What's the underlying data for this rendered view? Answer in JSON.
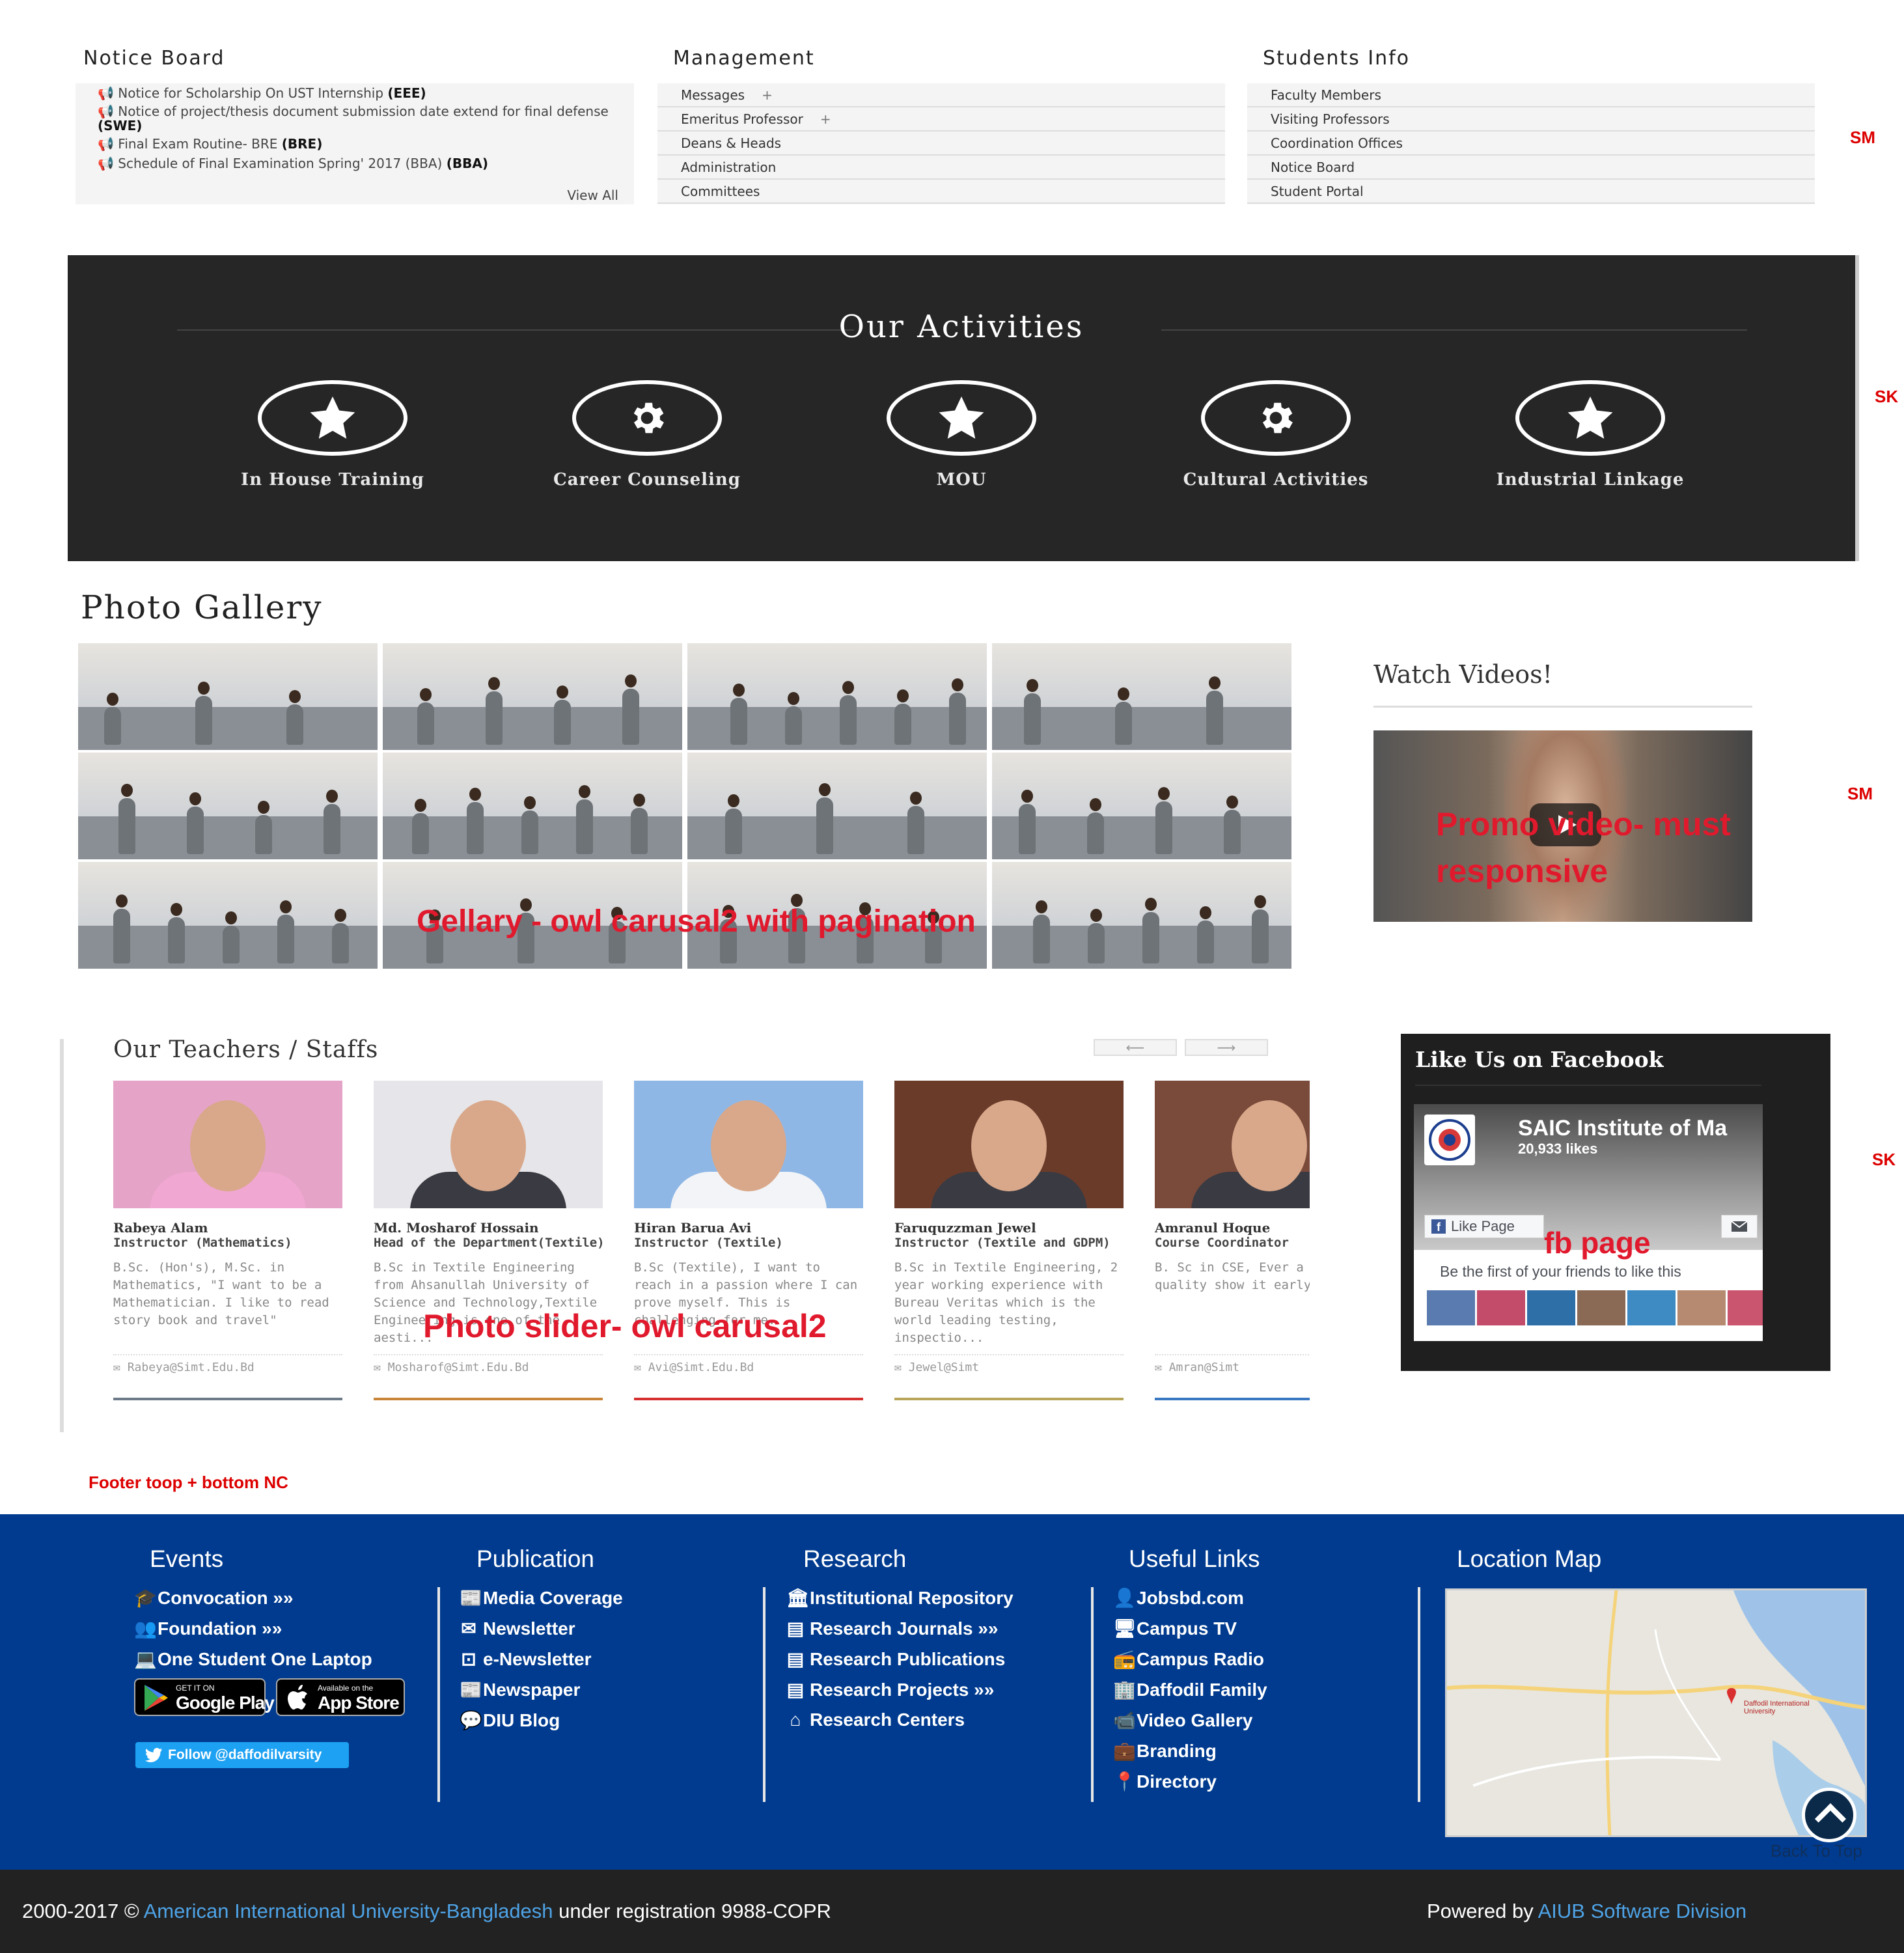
{
  "notice_board": {
    "title": "Notice Board",
    "items": [
      {
        "text": "Notice for Scholarship On UST Internship",
        "tag": "(EEE)"
      },
      {
        "text": "Notice of project/thesis document submission date extend for final defense",
        "tag": "(SWE)"
      },
      {
        "text": "Final Exam Routine- BRE",
        "tag": "(BRE)"
      },
      {
        "text": "Schedule of Final Examination Spring' 2017 (BBA)",
        "tag": "(BBA)"
      }
    ],
    "view_all": "View All"
  },
  "management": {
    "title": "Management",
    "items": [
      {
        "label": "Messages",
        "expand": "+"
      },
      {
        "label": "Emeritus Professor",
        "expand": "+"
      },
      {
        "label": "Deans & Heads",
        "expand": ""
      },
      {
        "label": "Administration",
        "expand": ""
      },
      {
        "label": "Committees",
        "expand": ""
      }
    ]
  },
  "students_info": {
    "title": "Students Info",
    "items": [
      "Faculty Members",
      "Visiting Professors",
      "Coordination Offices",
      "Notice Board",
      "Student Portal"
    ]
  },
  "side_tags": {
    "top": "SM",
    "activities": "SK",
    "video": "SM",
    "facebook": "SK"
  },
  "activities": {
    "title": "Our Activities",
    "items": [
      {
        "label": "In House Training",
        "icon": "star-icon"
      },
      {
        "label": "Career Counseling",
        "icon": "gear-icon"
      },
      {
        "label": "MOU",
        "icon": "star-icon"
      },
      {
        "label": "Cultural Activities",
        "icon": "gear-icon"
      },
      {
        "label": "Industrial Linkage",
        "icon": "star-icon"
      }
    ]
  },
  "gallery": {
    "title": "Photo Gallery",
    "annotation": "Gellary - owl carusal2 with pagination",
    "photo_count": 12
  },
  "video": {
    "title": "Watch Videos!",
    "annotation": "Promo video- must responsive"
  },
  "teachers": {
    "title": "Our Teachers / Staffs",
    "prev": "⟵",
    "next": "⟶",
    "annotation": "Photo slider- owl carusal2",
    "items": [
      {
        "name": "Rabeya Alam",
        "role": "Instructor (Mathematics)",
        "desc": "B.Sc. (Hon's), M.Sc. in Mathematics, \"I want to be a Mathematician. I like to read story book and travel\"",
        "email": "Rabeya@Simt.Edu.Bd",
        "color": "#e5a3c8",
        "bar": "#6c7a89"
      },
      {
        "name": "Md. Mosharof Hossain",
        "role": "Head of the Department(Textile)",
        "desc": "B.Sc in Textile Engineering from Ahsanullah University of Science and Technology,Textile Engineering is one of the aesti...",
        "email": "Mosharof@Simt.Edu.Bd",
        "color": "#e6e6ea",
        "bar": "#c9863a"
      },
      {
        "name": "Hiran Barua Avi",
        "role": "Instructor (Textile)",
        "desc": "B.Sc (Textile), I want to reach in a passion where I can prove myself. This is challenging for me.",
        "email": "Avi@Simt.Edu.Bd",
        "color": "#8fb7e6",
        "bar": "#d62f2f"
      },
      {
        "name": "Faruquzzman Jewel",
        "role": "Instructor (Textile and GDPM)",
        "desc": "B.Sc in Textile Engineering, 2 year working experience with Bureau Veritas which is the world leading testing, inspectio...",
        "email": "Jewel@Simt",
        "color": "#6b3b2a",
        "bar": "#b8a55a"
      },
      {
        "name": "Amranul Hoque",
        "role": "Course Coordinator",
        "desc": "B. Sc in CSE, Ever a different quality show it early",
        "email": "Amran@Simt",
        "color": "#7a4a3a",
        "bar": "#3a78c2"
      }
    ]
  },
  "facebook": {
    "title": "Like Us on Facebook",
    "page_name": "SAIC Institute of Ma",
    "likes": "20,933 likes",
    "like_button": "Like Page",
    "friends_text": "Be the first of your friends to like this",
    "annotation": "fb page"
  },
  "footer_note": "Footer toop + bottom NC",
  "footer": {
    "events": {
      "title": "Events",
      "links": [
        {
          "label": "Convocation »»",
          "icon": "graduation-cap-icon"
        },
        {
          "label": "Foundation »»",
          "icon": "users-icon"
        },
        {
          "label": "One Student One Laptop",
          "icon": "laptop-icon"
        }
      ],
      "google_play_small": "GET IT ON",
      "google_play": "Google Play",
      "app_store_small": "Available on the",
      "app_store": "App Store",
      "twitter": "Follow @daffodilvarsity"
    },
    "publication": {
      "title": "Publication",
      "links": [
        {
          "label": "Media Coverage",
          "icon": "newspaper-icon"
        },
        {
          "label": "Newsletter",
          "icon": "envelope-icon"
        },
        {
          "label": "e-Newsletter",
          "icon": "envelope-square-icon"
        },
        {
          "label": "Newspaper",
          "icon": "newspaper-icon"
        },
        {
          "label": "DIU Blog",
          "icon": "comment-icon"
        }
      ]
    },
    "research": {
      "title": "Research",
      "links": [
        {
          "label": "Institutional Repository",
          "icon": "institution-icon"
        },
        {
          "label": "Research Journals »»",
          "icon": "file-icon"
        },
        {
          "label": "Research Publications",
          "icon": "file-text-icon"
        },
        {
          "label": "Research Projects »»",
          "icon": "file-icon"
        },
        {
          "label": "Research Centers",
          "icon": "home-icon"
        }
      ]
    },
    "useful_links": {
      "title": "Useful Links",
      "links": [
        {
          "label": "Jobsbd.com",
          "icon": "user-icon"
        },
        {
          "label": "Campus TV",
          "icon": "desktop-icon"
        },
        {
          "label": "Campus Radio",
          "icon": "radio-icon"
        },
        {
          "label": "Daffodil Family",
          "icon": "building-icon"
        },
        {
          "label": "Video Gallery",
          "icon": "video-camera-icon"
        },
        {
          "label": "Branding",
          "icon": "briefcase-icon"
        },
        {
          "label": "Directory",
          "icon": "map-marker-icon"
        }
      ]
    },
    "location": {
      "title": "Location Map",
      "map_label": "Daffodil International University",
      "back_to_top": "Back To Top"
    }
  },
  "bottom_bar": {
    "copyright_prefix": "2000-2017 ©",
    "university": "American International University-Bangladesh",
    "registration": "under registration 9988-COPR",
    "powered_by": "Powered by",
    "division": "AIUB Software Division"
  }
}
